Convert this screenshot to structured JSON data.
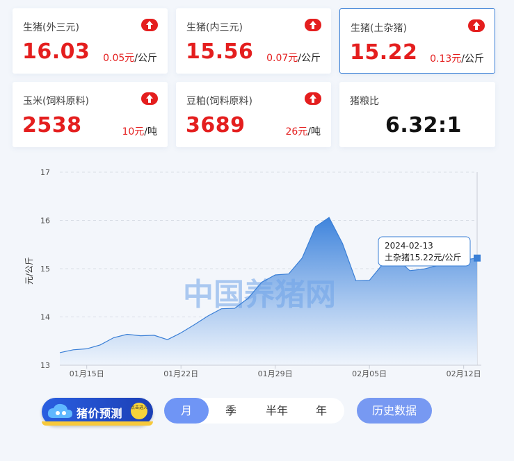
{
  "cards": [
    {
      "title": "生猪(外三元)",
      "value": "16.03",
      "change": "0.05元",
      "unit": "/公斤",
      "trend": "up"
    },
    {
      "title": "生猪(内三元)",
      "value": "15.56",
      "change": "0.07元",
      "unit": "/公斤",
      "trend": "up"
    },
    {
      "title": "生猪(土杂猪)",
      "value": "15.22",
      "change": "0.13元",
      "unit": "/公斤",
      "trend": "up"
    },
    {
      "title": "玉米(饲料原料)",
      "value": "2538",
      "change": "10元",
      "unit": "/吨",
      "trend": "up"
    },
    {
      "title": "豆粕(饲料原料)",
      "value": "3689",
      "change": "26元",
      "unit": "/吨",
      "trend": "up"
    },
    {
      "title": "猪粮比",
      "value": "6.32:1"
    }
  ],
  "chart_data": {
    "type": "area",
    "ylabel": "元/公斤",
    "ylim": [
      13,
      17
    ],
    "yticks": [
      13,
      14,
      15,
      16,
      17
    ],
    "xticks": [
      "01月15日",
      "01月22日",
      "01月29日",
      "02月05日",
      "02月12日"
    ],
    "x": [
      "2024-01-13",
      "2024-01-14",
      "2024-01-15",
      "2024-01-16",
      "2024-01-17",
      "2024-01-18",
      "2024-01-19",
      "2024-01-20",
      "2024-01-21",
      "2024-01-22",
      "2024-01-23",
      "2024-01-24",
      "2024-01-25",
      "2024-01-26",
      "2024-01-27",
      "2024-01-28",
      "2024-01-29",
      "2024-01-30",
      "2024-01-31",
      "2024-02-01",
      "2024-02-02",
      "2024-02-03",
      "2024-02-04",
      "2024-02-05",
      "2024-02-06",
      "2024-02-07",
      "2024-02-08",
      "2024-02-09",
      "2024-02-10",
      "2024-02-11",
      "2024-02-12",
      "2024-02-13"
    ],
    "series": [
      {
        "name": "土杂猪",
        "values": [
          13.26,
          13.32,
          13.34,
          13.42,
          13.57,
          13.64,
          13.61,
          13.62,
          13.53,
          13.67,
          13.84,
          14.02,
          14.17,
          14.18,
          14.39,
          14.72,
          14.87,
          14.89,
          15.22,
          15.87,
          16.06,
          15.52,
          14.75,
          14.76,
          15.1,
          15.21,
          14.96,
          14.99,
          15.06,
          15.12,
          15.18,
          15.22
        ]
      }
    ],
    "tooltip": {
      "date": "2024-02-13",
      "text": "土杂猪15.22元/公斤"
    },
    "watermark": "中国养猪网",
    "colors": {
      "line": "#3a7fd6",
      "fill_top": "#3f84dc",
      "fill_bottom": "#eef4fc",
      "grid": "#d8dde6",
      "axis": "#c8ccd4",
      "tick": "#555555"
    }
  },
  "controls": {
    "predict_label": "猪价预测",
    "predict_badge": "点击进入",
    "periods": [
      "月",
      "季",
      "半年",
      "年"
    ],
    "active_period": "月",
    "history_label": "历史数据"
  }
}
